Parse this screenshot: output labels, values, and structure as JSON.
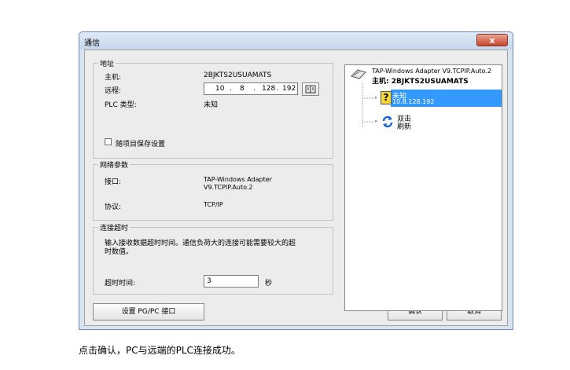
{
  "window": {
    "title": "通信",
    "close_label": "x"
  },
  "address": {
    "legend": "地址",
    "host_label": "主机:",
    "host_value": "2BJKTS2USUAMATS",
    "remote_label": "远程:",
    "ip_octets": [
      "10",
      "8",
      "128",
      "192"
    ],
    "plc_type_label": "PLC 类型:",
    "plc_type_value": "未知",
    "save_checkbox_label": "随项目保存设置",
    "save_checked": false
  },
  "network": {
    "legend": "网络参数",
    "interface_label": "接口:",
    "interface_value_line1": "TAP-Windows Adapter",
    "interface_value_line2": "V9.TCPIP.Auto.2",
    "protocol_label": "协议:",
    "protocol_value": "TCP/IP"
  },
  "timeout": {
    "legend": "连接超时",
    "description_line1": "输入接收数据超时时间。通信负荷大的连接可能需要较大的超",
    "description_line2": "时数值。",
    "time_label": "超时时间:",
    "time_value": "3",
    "unit": "秒"
  },
  "buttons": {
    "set_pgpc": "设置 PG/PC 接口",
    "ok": "确认",
    "cancel": "取消"
  },
  "tree": {
    "root_line1": "TAP-Windows Adapter V9.TCPIP.Auto.2",
    "root_line2": "主机:  2BJKTS2USUAMATS",
    "unknown_name": "未知",
    "unknown_ip": "10.8.128.192",
    "refresh_line1": "双击",
    "refresh_line2": "刷新"
  },
  "caption": "点击确认，PC与远端的PLC连接成功。",
  "colors": {
    "selection": "#3399ff",
    "close_button": "#c7452c",
    "refresh_icon": "#1a5fd0"
  }
}
